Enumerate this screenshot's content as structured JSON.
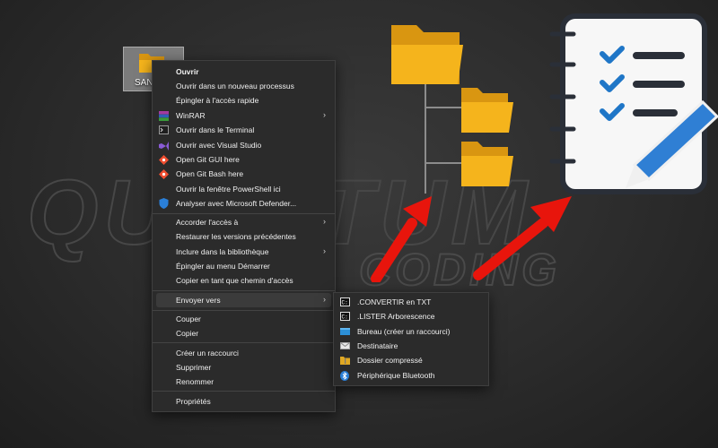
{
  "watermark": {
    "line1": "QUANTUM",
    "line2": "CODING"
  },
  "desktop_icon": {
    "label": "SAN"
  },
  "context_menu": {
    "items": [
      {
        "label": "Ouvrir",
        "icon": "none"
      },
      {
        "label": "Ouvrir dans un nouveau processus",
        "icon": "none"
      },
      {
        "label": "Épingler à l'accès rapide",
        "icon": "none"
      },
      {
        "label": "WinRAR",
        "icon": "winrar-icon"
      },
      {
        "label": "Ouvrir dans le Terminal",
        "icon": "terminal-icon"
      },
      {
        "label": "Ouvrir avec Visual Studio",
        "icon": "visual-studio-icon"
      },
      {
        "label": "Open Git GUI here",
        "icon": "git-icon"
      },
      {
        "label": "Open Git Bash here",
        "icon": "git-icon"
      },
      {
        "label": "Ouvrir la fenêtre PowerShell ici",
        "icon": "none"
      },
      {
        "label": "Analyser avec Microsoft Defender...",
        "icon": "defender-shield-icon"
      },
      {
        "label": "Accorder l'accès à",
        "icon": "none"
      },
      {
        "label": "Restaurer les versions précédentes",
        "icon": "none"
      },
      {
        "label": "Inclure dans la bibliothèque",
        "icon": "none"
      },
      {
        "label": "Épingler au menu Démarrer",
        "icon": "none"
      },
      {
        "label": "Copier en tant que chemin d'accès",
        "icon": "none"
      },
      {
        "label": "Envoyer vers",
        "icon": "none"
      },
      {
        "label": "Couper",
        "icon": "none"
      },
      {
        "label": "Copier",
        "icon": "none"
      },
      {
        "label": "Créer un raccourci",
        "icon": "none"
      },
      {
        "label": "Supprimer",
        "icon": "none"
      },
      {
        "label": "Renommer",
        "icon": "none"
      },
      {
        "label": "Propriétés",
        "icon": "none"
      }
    ]
  },
  "send_to_menu": {
    "items": [
      {
        "label": ".CONVERTIR en TXT",
        "icon": "cmd-script-icon"
      },
      {
        "label": ".LISTER Arborescence",
        "icon": "cmd-script-icon"
      },
      {
        "label": "Bureau (créer un raccourci)",
        "icon": "desktop-icon"
      },
      {
        "label": "Destinataire",
        "icon": "mail-icon"
      },
      {
        "label": "Dossier compressé",
        "icon": "zip-folder-icon"
      },
      {
        "label": "Périphérique Bluetooth",
        "icon": "bluetooth-icon"
      }
    ]
  },
  "colors": {
    "folder": "#f2b21b",
    "arrow": "#e8150c",
    "checklist_check": "#1f76c7",
    "pencil": "#2f7fd4"
  }
}
